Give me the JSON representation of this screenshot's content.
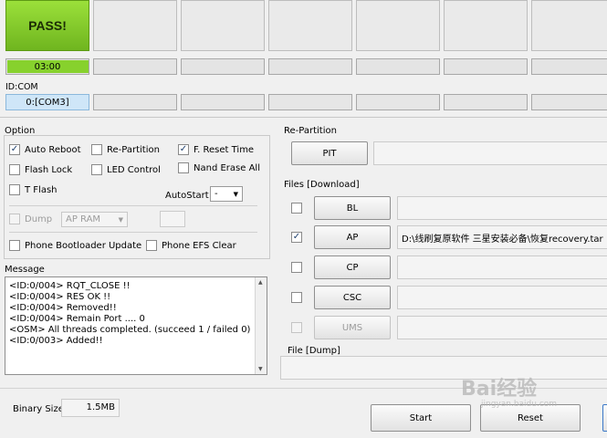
{
  "status": {
    "pass_label": "PASS!",
    "timer": "03:00",
    "progress": 1.0
  },
  "id_com": {
    "label": "ID:COM",
    "port": "0:[COM3]"
  },
  "option": {
    "title": "Option",
    "auto_reboot": {
      "label": "Auto Reboot",
      "checked": true
    },
    "re_partition": {
      "label": "Re-Partition",
      "checked": false
    },
    "f_reset_time": {
      "label": "F. Reset Time",
      "checked": true
    },
    "flash_lock": {
      "label": "Flash Lock",
      "checked": false
    },
    "led_control": {
      "label": "LED Control",
      "checked": false
    },
    "nand_erase_all": {
      "label": "Nand Erase All",
      "checked": false
    },
    "t_flash": {
      "label": "T Flash",
      "checked": false
    },
    "autostart_label": "AutoStart",
    "autostart_value": "-",
    "dump": {
      "label": "Dump",
      "checked": false
    },
    "dump_select": "AP RAM",
    "phone_bootloader_update": {
      "label": "Phone Bootloader Update",
      "checked": false
    },
    "phone_efs_clear": {
      "label": "Phone EFS Clear",
      "checked": false
    }
  },
  "message": {
    "title": "Message",
    "lines": [
      "<ID:0/004> RQT_CLOSE !!",
      "<ID:0/004> RES OK !!",
      "<ID:0/004> Removed!!",
      "<ID:0/004> Remain Port ....  0",
      "<OSM> All threads completed. (succeed 1 / failed 0)",
      "<ID:0/003> Added!!"
    ]
  },
  "repartition": {
    "title": "Re-Partition",
    "pit_label": "PIT"
  },
  "files": {
    "title": "Files [Download]",
    "rows": [
      {
        "label": "BL",
        "checked": false,
        "path": "",
        "enabled": true
      },
      {
        "label": "AP",
        "checked": true,
        "path": "D:\\线刷复原软件 三星安装必备\\恢复recovery.tar",
        "enabled": true
      },
      {
        "label": "CP",
        "checked": false,
        "path": "",
        "enabled": true
      },
      {
        "label": "CSC",
        "checked": false,
        "path": "",
        "enabled": true
      },
      {
        "label": "UMS",
        "checked": false,
        "path": "",
        "enabled": false
      }
    ]
  },
  "file_dump": {
    "title": "File [Dump]"
  },
  "binary_size": {
    "label": "Binary Size",
    "value": "1.5MB"
  },
  "actions": {
    "start": "Start",
    "reset": "Reset"
  },
  "watermark": {
    "main": "Bai经验",
    "sub": "jingyan.baidu.com"
  }
}
